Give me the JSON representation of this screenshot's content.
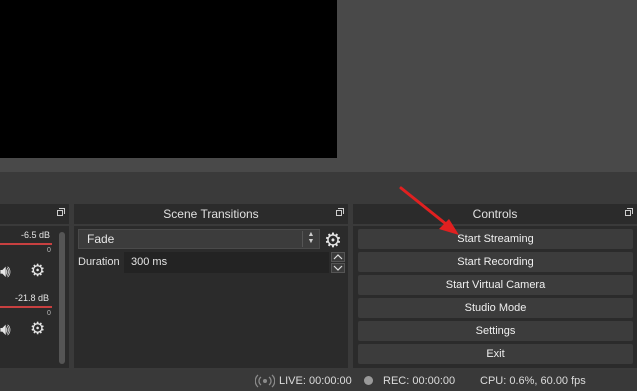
{
  "docks": {
    "transitions_title": "Scene Transitions",
    "controls_title": "Controls"
  },
  "mixer": {
    "tracks": [
      {
        "db": "-6.5 dB",
        "tick": "0"
      },
      {
        "db": "-21.8 dB",
        "tick": "0"
      }
    ]
  },
  "transitions": {
    "selected": "Fade",
    "duration_label": "Duration",
    "duration_value": "300 ms"
  },
  "controls": {
    "buttons": [
      "Start Streaming",
      "Start Recording",
      "Start Virtual Camera",
      "Studio Mode",
      "Settings",
      "Exit"
    ]
  },
  "status": {
    "live": "LIVE: 00:00:00",
    "rec": "REC: 00:00:00",
    "cpu": "CPU: 0.6%, 60.00 fps"
  },
  "colors": {
    "accent_arrow": "#e02020",
    "meter_red": "#c84040"
  }
}
